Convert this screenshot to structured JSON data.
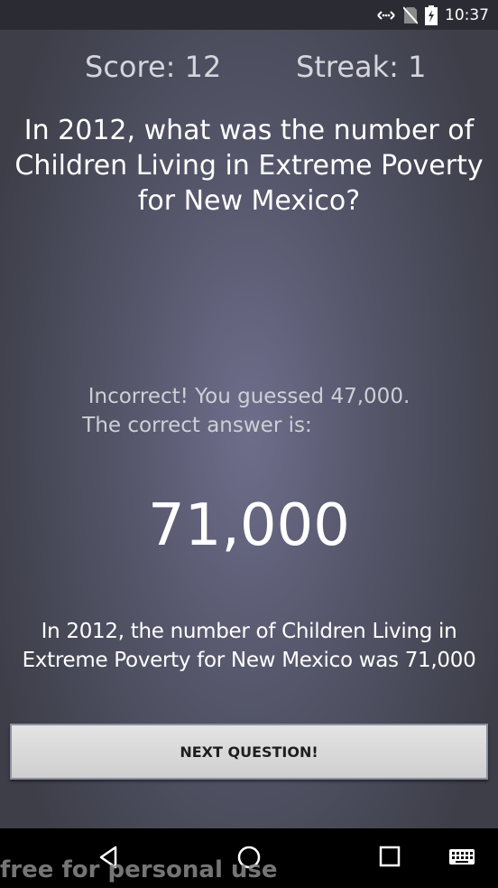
{
  "status_bar": {
    "time": "10:37",
    "icons": [
      "data-transfer-icon",
      "no-sim-icon",
      "battery-charging-icon"
    ]
  },
  "game": {
    "score_label": "Score: 12",
    "streak_label": "Streak: 1",
    "question": "In 2012, what was the number of Children Living in Extreme Poverty for New Mexico?",
    "feedback_line1": "Incorrect! You guessed 47,000.",
    "feedback_line2": "The correct answer is:",
    "answer": "71,000",
    "explanation": "In 2012, the number of Children Living in Extreme Poverty for New Mexico was 71,000",
    "next_button_label": "NEXT QUESTION!"
  },
  "nav_bar": {
    "buttons": [
      "back-icon",
      "home-icon",
      "recent-apps-icon",
      "keyboard-icon"
    ]
  },
  "watermark": "free for personal use"
}
